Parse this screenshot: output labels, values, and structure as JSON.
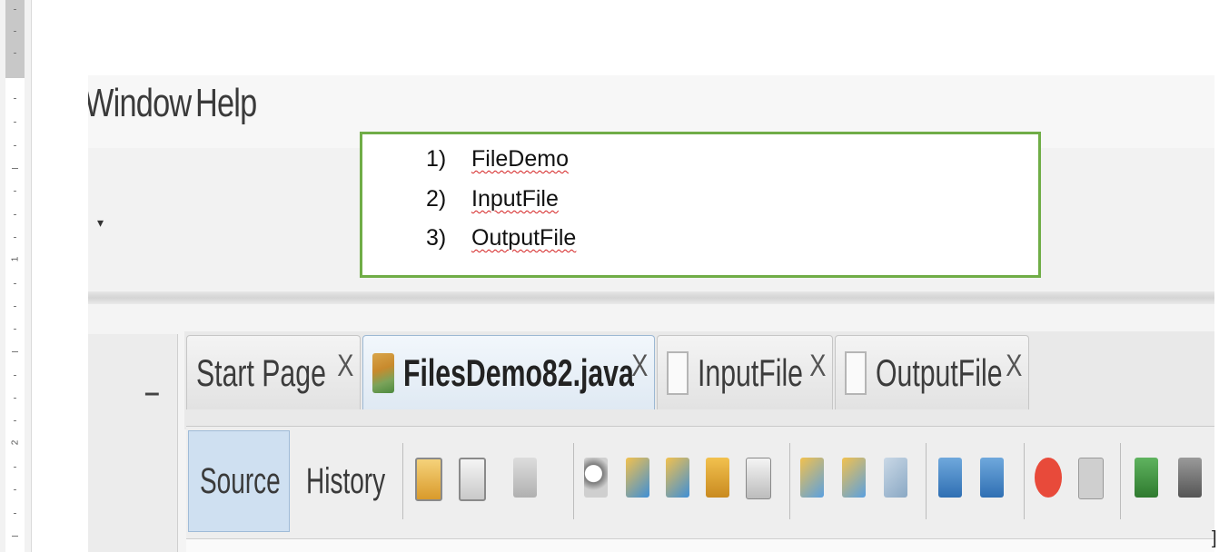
{
  "menu": {
    "window_label": "Window",
    "help_label": "Help"
  },
  "panel": {
    "minimize_glyph": "–",
    "combo_arrow_glyph": "▾"
  },
  "tabs": [
    {
      "label": "Start Page",
      "close": "X",
      "icon": "none",
      "active": false
    },
    {
      "label": "FilesDemo82.java",
      "close": "X",
      "icon": "java-file-icon",
      "active": true
    },
    {
      "label": "InputFile",
      "close": "X",
      "icon": "file-icon",
      "active": false
    },
    {
      "label": "OutputFile",
      "close": "X",
      "icon": "file-icon",
      "active": false
    }
  ],
  "editor_toolbar": {
    "source_label": "Source",
    "history_label": "History",
    "icons": [
      "last-edit-icon",
      "back-icon",
      "forward-icon",
      "find-icon",
      "find-previous-icon",
      "find-next-icon",
      "toggle-highlight-icon",
      "toggle-selection-icon",
      "previous-bookmark-icon",
      "next-bookmark-icon",
      "toggle-bookmark-icon",
      "shift-left-icon",
      "shift-right-icon",
      "start-macro-icon",
      "stop-macro-icon",
      "comment-icon",
      "uncomment-icon"
    ]
  },
  "list": {
    "items": [
      {
        "num": "1)",
        "text": "FileDemo"
      },
      {
        "num": "2)",
        "text": "InputFile"
      },
      {
        "num": "3)",
        "text": "OutputFile"
      }
    ]
  },
  "ruler": {
    "numbers": [
      "1",
      "2"
    ]
  },
  "colors": {
    "textbox_border": "#70ad47",
    "spellcheck_underline": "#d42020",
    "active_tab": "#dfe9f3"
  }
}
